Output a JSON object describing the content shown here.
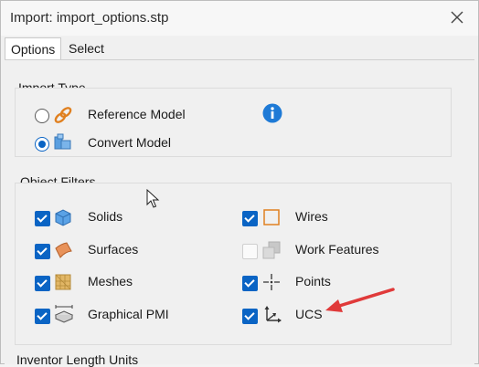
{
  "window": {
    "title": "Import:  import_options.stp"
  },
  "tabs": [
    {
      "label": "Options"
    },
    {
      "label": "Select"
    }
  ],
  "import_type": {
    "label": "Import Type",
    "options": [
      {
        "label": "Reference Model",
        "selected": false
      },
      {
        "label": "Convert Model",
        "selected": true
      }
    ]
  },
  "object_filters": {
    "label": "Object Filters",
    "items": [
      {
        "label": "Solids",
        "checked": true
      },
      {
        "label": "Wires",
        "checked": true
      },
      {
        "label": "Surfaces",
        "checked": true
      },
      {
        "label": "Work Features",
        "checked": false
      },
      {
        "label": "Meshes",
        "checked": true
      },
      {
        "label": "Points",
        "checked": true
      },
      {
        "label": "Graphical PMI",
        "checked": true
      },
      {
        "label": "UCS",
        "checked": true
      }
    ]
  },
  "length_units": {
    "label": "Inventor Length Units"
  },
  "colors": {
    "accent": "#0a64c4",
    "annotation_arrow": "#e03a3a"
  }
}
